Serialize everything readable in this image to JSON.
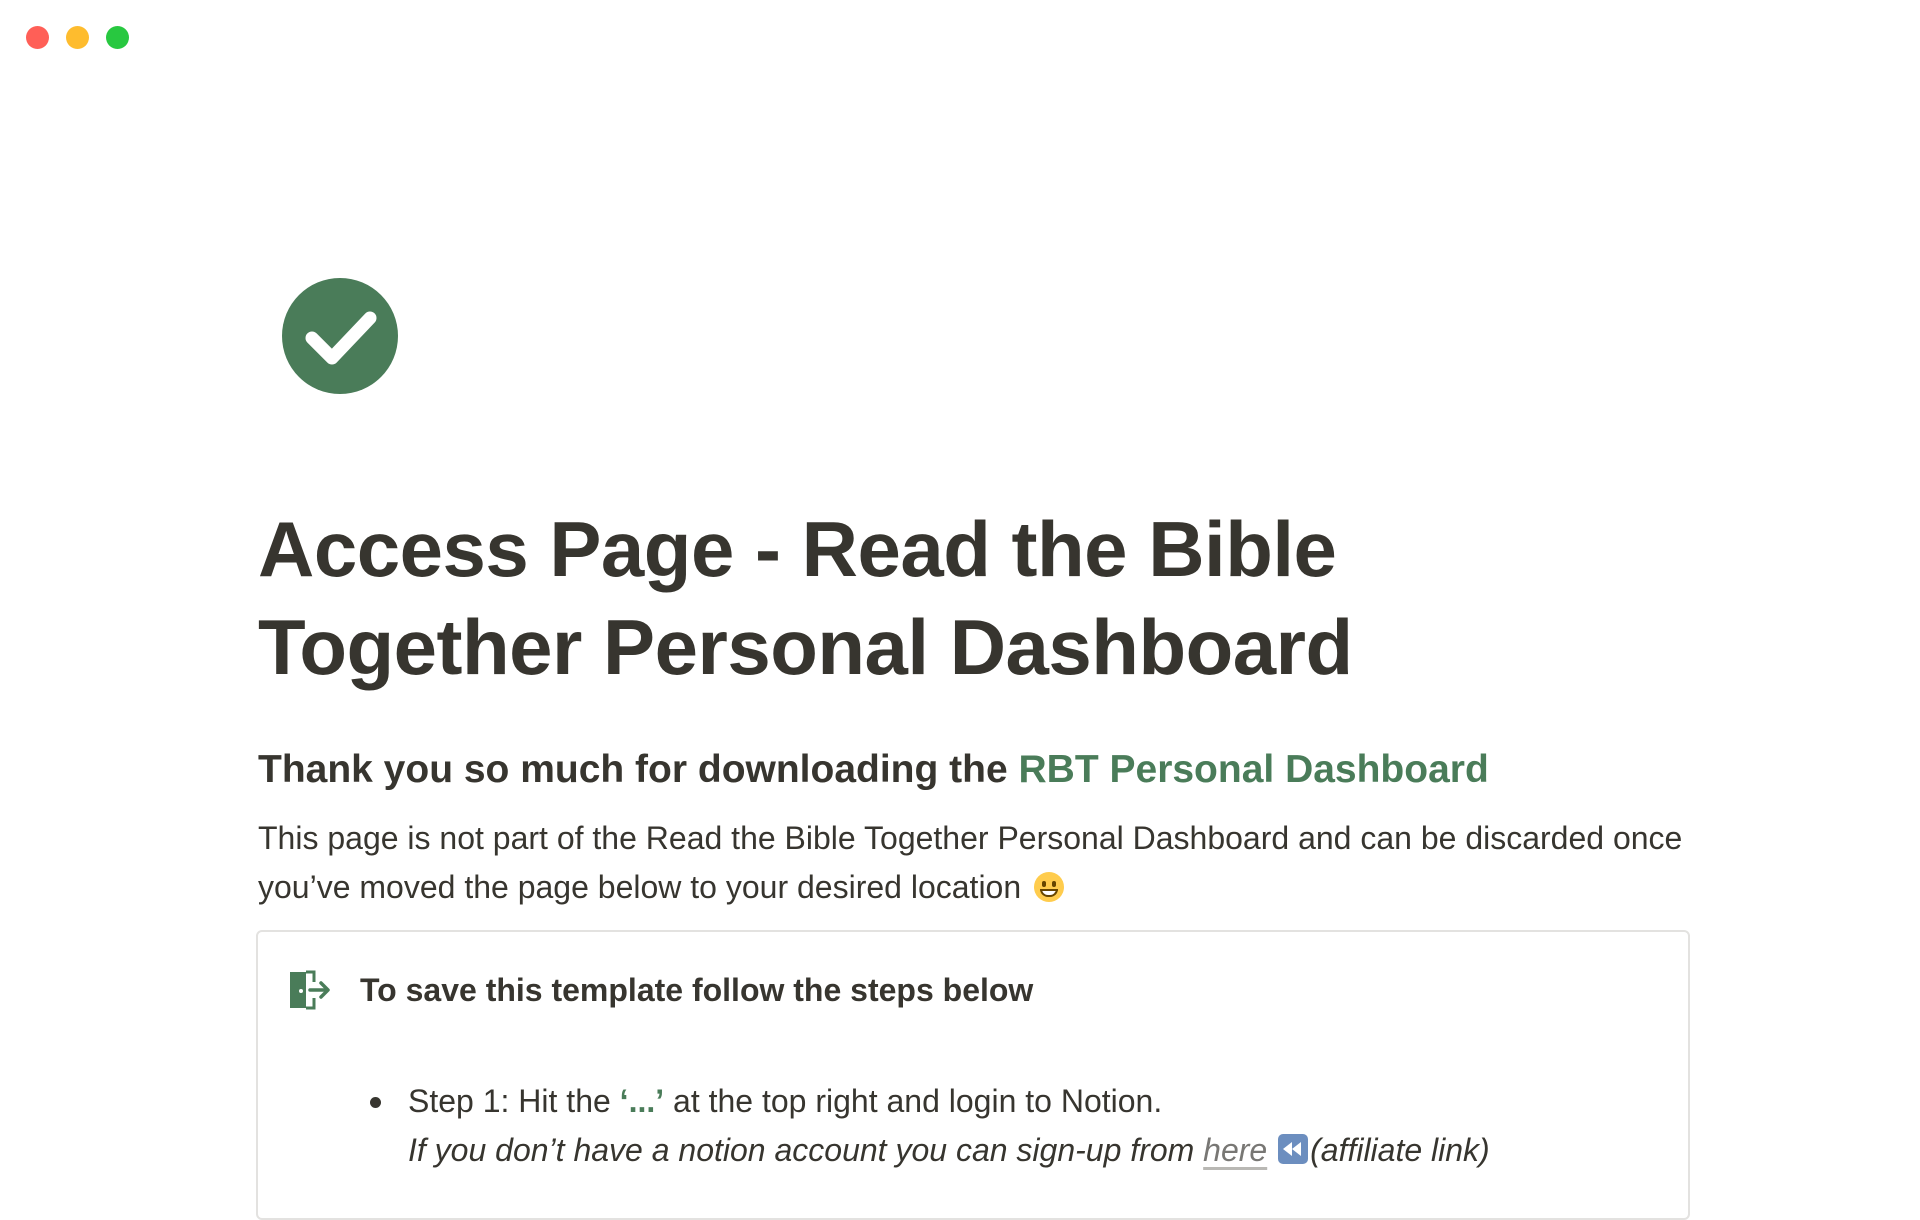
{
  "window": {
    "controls": [
      "close",
      "minimize",
      "maximize"
    ]
  },
  "page": {
    "icon": "check-circle-icon",
    "title": "Access Page - Read the Bible Together Personal Dashboard"
  },
  "heading": {
    "prefix": "Thank you so much for downloading the ",
    "accent": "RBT Personal Dashboard"
  },
  "intro": {
    "text": "This page is not part of the Read the Bible Together Personal Dashboard and can be discarded once you’ve moved the page below to your desired location",
    "emoji": "grinning-face-icon"
  },
  "callout": {
    "icon": "door-exit-icon",
    "title": "To save this template follow the steps below",
    "steps": [
      {
        "before": "Step 1: Hit the ",
        "code": "‘...’",
        "after": " at the top right and login to Notion.",
        "note_before": "If you don’t have a notion account you can sign-up from ",
        "link": "here",
        "note_after": "(affiliate link)"
      }
    ]
  },
  "colors": {
    "accent": "#4a7c59",
    "text": "#37352f",
    "border": "#e3e2e0"
  }
}
